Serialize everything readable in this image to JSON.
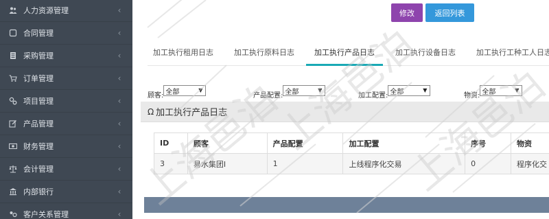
{
  "sidebar": {
    "items": [
      {
        "label": "人力资源管理",
        "icon": "users-icon"
      },
      {
        "label": "合同管理",
        "icon": "contract-icon"
      },
      {
        "label": "采购管理",
        "icon": "purchase-icon"
      },
      {
        "label": "订单管理",
        "icon": "cart-icon"
      },
      {
        "label": "项目管理",
        "icon": "project-icon"
      },
      {
        "label": "产品管理",
        "icon": "edit-icon"
      },
      {
        "label": "财务管理",
        "icon": "finance-icon"
      },
      {
        "label": "会计管理",
        "icon": "scale-icon"
      },
      {
        "label": "内部银行",
        "icon": "bank-icon"
      },
      {
        "label": "客户关系管理",
        "icon": "crm-icon"
      }
    ],
    "chevron": "‹"
  },
  "toolbar": {
    "edit_label": "修改",
    "back_label": "返回列表"
  },
  "tabs": [
    {
      "label": "加工执行租用日志",
      "active": false
    },
    {
      "label": "加工执行原料日志",
      "active": false
    },
    {
      "label": "加工执行产品日志",
      "active": true
    },
    {
      "label": "加工执行设备日志",
      "active": false
    },
    {
      "label": "加工执行工种工人日志",
      "active": false
    }
  ],
  "filters": [
    {
      "label": "顾客:",
      "value": "全部"
    },
    {
      "label": "产品配置:",
      "value": "全部"
    },
    {
      "label": "加工配置:",
      "value": "全部"
    },
    {
      "label": "物资:",
      "value": "全部"
    }
  ],
  "panel": {
    "title": "加工执行产品日志",
    "icon": "omega-icon"
  },
  "table": {
    "columns": [
      "ID",
      "顾客",
      "产品配置",
      "加工配置",
      "序号",
      "物资"
    ],
    "rows": [
      [
        "3",
        "易水集团I",
        "1",
        "上线程序化交易",
        "0",
        "程序化交"
      ]
    ]
  },
  "colors": {
    "sidebar_bg": "#3f4853",
    "edit_button": "#8e44ad",
    "back_button": "#3498db",
    "active_tab_underline": "#19a9b5",
    "footer_bar": "#6e8199"
  },
  "watermark": {
    "text": "上海邑泊"
  }
}
